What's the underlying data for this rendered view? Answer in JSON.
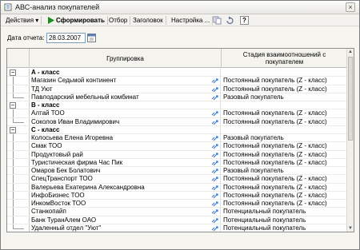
{
  "window": {
    "title": "АВС-анализ покупателей",
    "close_glyph": "×"
  },
  "toolbar": {
    "actions": "Действия",
    "generate": "Сформировать",
    "selection": "Отбор",
    "header": "Заголовок",
    "settings": "Настройка ...",
    "help": "?"
  },
  "report_date": {
    "label": "Дата отчета:",
    "value": "28.03.2007"
  },
  "table": {
    "columns": [
      "Группировка",
      "Стадия взаимоотношений с покупателем"
    ],
    "rows": [
      {
        "type": "group",
        "name": "А - класс",
        "stage": ""
      },
      {
        "type": "item",
        "name": "Магазин Седьмой континент",
        "stage": "Постоянный покупатель (Z - класс)"
      },
      {
        "type": "item",
        "name": "ТД Уют",
        "stage": "Постоянный покупатель (Z - класс)"
      },
      {
        "type": "item",
        "name": "Павлодарский мебельный комбинат",
        "stage": "Разовый покупатель"
      },
      {
        "type": "group",
        "name": "В - класс",
        "stage": ""
      },
      {
        "type": "item",
        "name": "Алтай ТОО",
        "stage": "Постоянный покупатель (Z - класс)"
      },
      {
        "type": "item",
        "name": "Соколов Иван Владимирович",
        "stage": "Постоянный покупатель (Z - класс)"
      },
      {
        "type": "group",
        "name": "С - класс",
        "stage": ""
      },
      {
        "type": "item",
        "name": "Колосьева Елена Игоревна",
        "stage": "Разовый покупатель"
      },
      {
        "type": "item",
        "name": "Смак ТОО",
        "stage": "Постоянный покупатель (Z - класс)"
      },
      {
        "type": "item",
        "name": "Продуктовый рай",
        "stage": "Постоянный покупатель (Z - класс)"
      },
      {
        "type": "item",
        "name": "Туристическая фирма Час Пик",
        "stage": "Постоянный покупатель (Z - класс)"
      },
      {
        "type": "item",
        "name": "Омаров Бек Болатович",
        "stage": "Разовый покупатель"
      },
      {
        "type": "item",
        "name": "СпецТранспорт ТОО",
        "stage": "Постоянный покупатель (Z - класс)"
      },
      {
        "type": "item",
        "name": "Валерьева Екатерина Александровна",
        "stage": "Постоянный покупатель (Z - класс)"
      },
      {
        "type": "item",
        "name": "ИнфоБизнес ТОО",
        "stage": "Постоянный покупатель (Z - класс)"
      },
      {
        "type": "item",
        "name": "ИнкомВосток ТОО",
        "stage": "Постоянный покупатель (Z - класс)"
      },
      {
        "type": "item",
        "name": "Станкопайп",
        "stage": "Потенциальный покупатель"
      },
      {
        "type": "item",
        "name": "Банк ТуранАлем ОАО",
        "stage": "Потенциальный покупатель"
      },
      {
        "type": "item",
        "name": "Удаленный отдел \"Уют\"",
        "stage": "Потенциальный покупатель"
      }
    ]
  },
  "icons": {
    "app": "report-icon",
    "generate": "play-arrow-icon",
    "row_link": "link-icon",
    "calendar": "calendar-icon",
    "tree_toggle": "minus-box-icon"
  },
  "colors": {
    "generate_arrow": "#1f8a1f",
    "link_icon": "#3a7bd5",
    "header_bg": "#f4f3ee"
  }
}
